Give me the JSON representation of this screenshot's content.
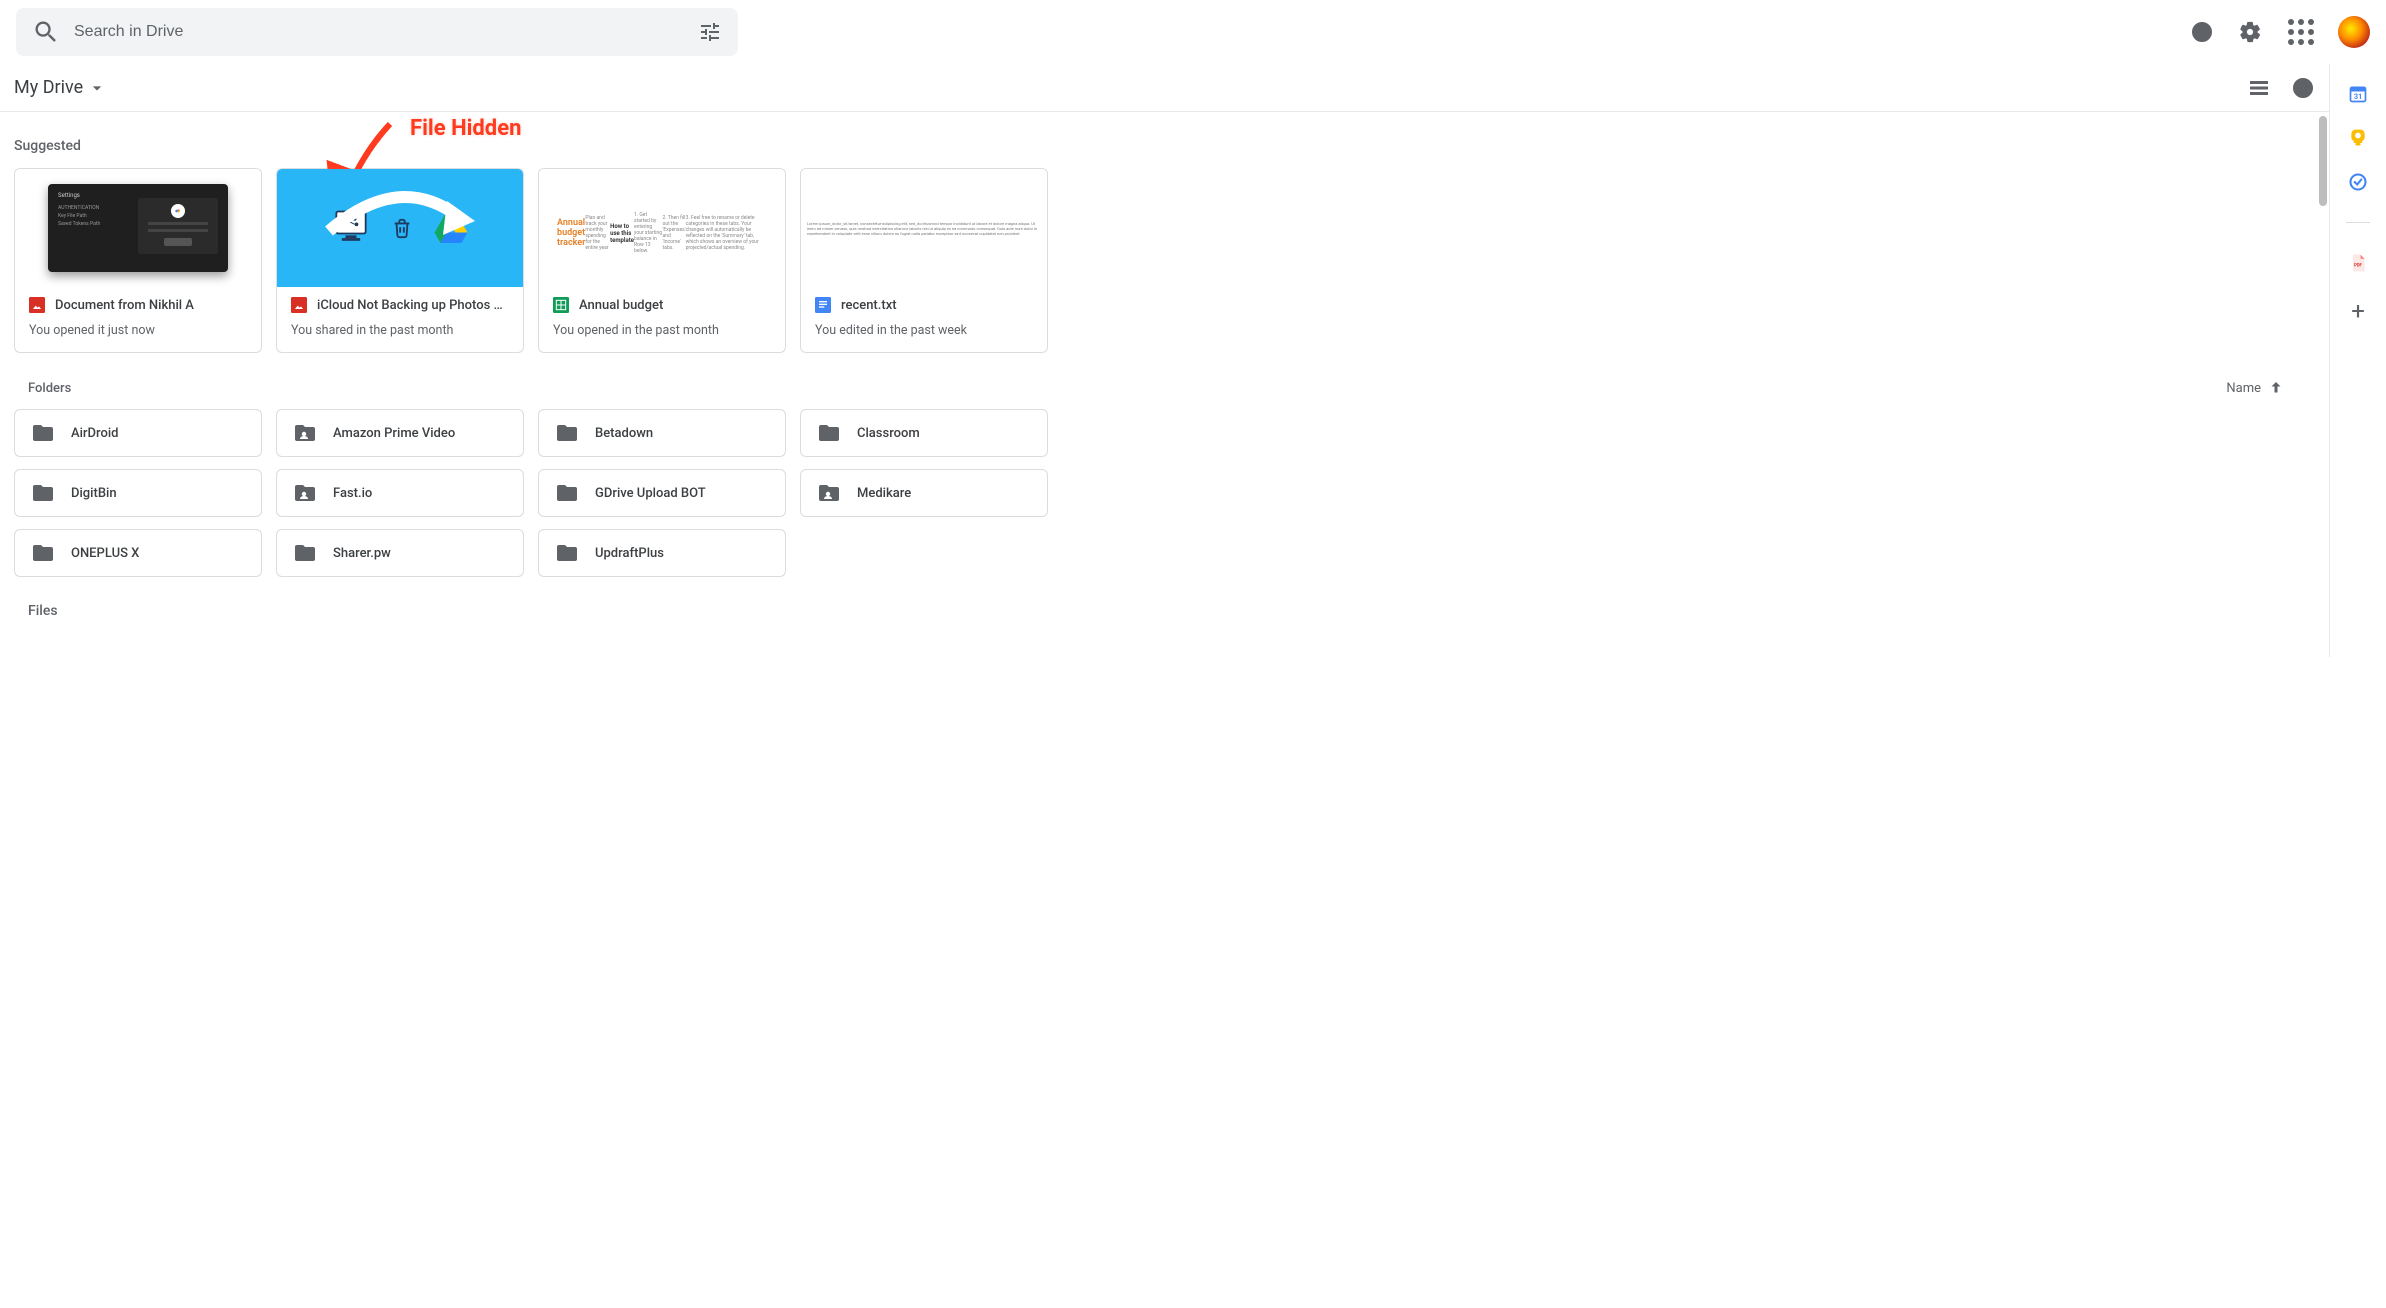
{
  "search": {
    "placeholder": "Search in Drive"
  },
  "location": {
    "title": "My Drive"
  },
  "annotation": {
    "text": "File Hidden"
  },
  "sections": {
    "suggested_label": "Suggested",
    "folders_label": "Folders",
    "files_label": "Files",
    "sort_label": "Name"
  },
  "suggested": [
    {
      "title": "Document from Nikhil A",
      "subtitle": "You opened it just now",
      "icon": "image"
    },
    {
      "title": "iCloud Not Backing up Photos …",
      "subtitle": "You shared in the past month",
      "icon": "image"
    },
    {
      "title": "Annual budget",
      "subtitle": "You opened in the past month",
      "icon": "sheets"
    },
    {
      "title": "recent.txt",
      "subtitle": "You edited in the past week",
      "icon": "docs"
    }
  ],
  "thumb_budget": {
    "title": "Annual budget tracker",
    "sub": "Plan and track your monthly spending for the entire year",
    "howto": "How to use this template",
    "l1": "1. Get started by entering your starting balance in Row 13 below.",
    "l2": "2. Then fill out the 'Expenses' and 'Income' tabs.",
    "l3": "3. Feel free to rename or delete categories in these tabs. Your changes will automatically be reflected on the 'Summary' tab, which shows an overview of your projected/actual spending."
  },
  "folders": [
    {
      "name": "AirDroid",
      "type": "folder"
    },
    {
      "name": "Amazon Prime Video",
      "type": "shared"
    },
    {
      "name": "Betadown",
      "type": "folder"
    },
    {
      "name": "Classroom",
      "type": "folder"
    },
    {
      "name": "DigitBin",
      "type": "folder"
    },
    {
      "name": "Fast.io",
      "type": "shared"
    },
    {
      "name": "GDrive Upload BOT",
      "type": "folder"
    },
    {
      "name": "Medikare",
      "type": "shared"
    },
    {
      "name": "ONEPLUS X",
      "type": "folder"
    },
    {
      "name": "Sharer.pw",
      "type": "folder"
    },
    {
      "name": "UpdraftPlus",
      "type": "folder"
    }
  ]
}
